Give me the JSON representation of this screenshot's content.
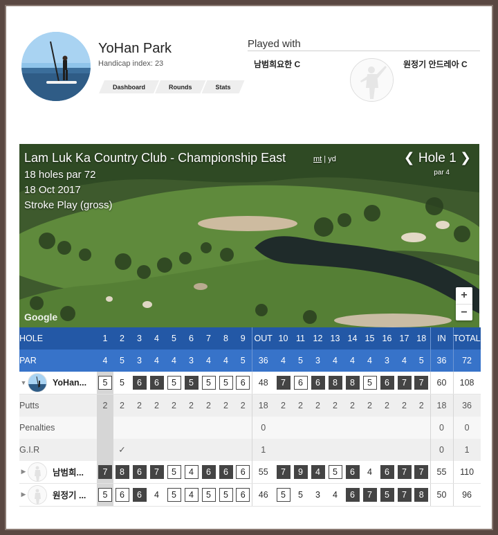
{
  "profile": {
    "name": "YoHan Park",
    "handicap": "Handicap index: 23",
    "nav": [
      "Dashboard",
      "Rounds",
      "Stats"
    ]
  },
  "played_with": {
    "title": "Played with",
    "partners": [
      "남범희요한 C",
      "원정기 안드레아 C"
    ]
  },
  "map": {
    "course": "Lam Luk Ka Country Club - Championship East",
    "units_mt": "mt",
    "units_sep": "|",
    "units_yd": "yd",
    "holes_par": "18 holes par 72",
    "date": "18 Oct 2017",
    "format": "Stroke Play (gross)",
    "hole_label": "Hole 1",
    "hole_prev": "❮",
    "hole_next": "❯",
    "hole_par": "par 4",
    "zoom_in": "+",
    "zoom_out": "−",
    "google": "Google"
  },
  "scorecard": {
    "hole_label": "HOLE",
    "par_label": "PAR",
    "holes": [
      "1",
      "2",
      "3",
      "4",
      "5",
      "6",
      "7",
      "8",
      "9",
      "OUT",
      "10",
      "11",
      "12",
      "13",
      "14",
      "15",
      "16",
      "17",
      "18",
      "IN",
      "TOTAL"
    ],
    "pars": [
      "4",
      "5",
      "3",
      "4",
      "4",
      "3",
      "4",
      "4",
      "5",
      "36",
      "4",
      "5",
      "3",
      "4",
      "4",
      "4",
      "3",
      "4",
      "5",
      "36",
      "72"
    ],
    "rows": [
      {
        "type": "player",
        "name": "YoHan...",
        "expanded": true,
        "cells": [
          {
            "v": "5",
            "s": "box"
          },
          {
            "v": "5",
            "s": "plain"
          },
          {
            "v": "6",
            "s": "dark"
          },
          {
            "v": "6",
            "s": "dark"
          },
          {
            "v": "5",
            "s": "box"
          },
          {
            "v": "5",
            "s": "dark"
          },
          {
            "v": "5",
            "s": "box"
          },
          {
            "v": "5",
            "s": "box"
          },
          {
            "v": "6",
            "s": "box"
          },
          {
            "v": "48",
            "s": "sum"
          },
          {
            "v": "7",
            "s": "dark"
          },
          {
            "v": "6",
            "s": "box"
          },
          {
            "v": "6",
            "s": "dark"
          },
          {
            "v": "8",
            "s": "dark"
          },
          {
            "v": "8",
            "s": "dark"
          },
          {
            "v": "5",
            "s": "box"
          },
          {
            "v": "6",
            "s": "dark"
          },
          {
            "v": "7",
            "s": "dark"
          },
          {
            "v": "7",
            "s": "dark"
          },
          {
            "v": "60",
            "s": "sum"
          },
          {
            "v": "108",
            "s": "sum"
          }
        ]
      },
      {
        "type": "stat",
        "name": "Putts",
        "cells": [
          "2",
          "2",
          "2",
          "2",
          "2",
          "2",
          "2",
          "2",
          "2",
          "18",
          "2",
          "2",
          "2",
          "2",
          "2",
          "2",
          "2",
          "2",
          "2",
          "18",
          "36"
        ]
      },
      {
        "type": "stat",
        "name": "Penalties",
        "cells": [
          "",
          "",
          "",
          "",
          "",
          "",
          "",
          "",
          "",
          "0",
          "",
          "",
          "",
          "",
          "",
          "",
          "",
          "",
          "",
          "0",
          "0"
        ]
      },
      {
        "type": "stat",
        "name": "G.I.R",
        "cells": [
          "",
          "✓",
          "",
          "",
          "",
          "",
          "",
          "",
          "",
          "1",
          "",
          "",
          "",
          "",
          "",
          "",
          "",
          "",
          "",
          "0",
          "1"
        ]
      },
      {
        "type": "player",
        "name": "남범희...",
        "expanded": false,
        "cells": [
          {
            "v": "7",
            "s": "dark"
          },
          {
            "v": "8",
            "s": "dark"
          },
          {
            "v": "6",
            "s": "dark"
          },
          {
            "v": "7",
            "s": "dark"
          },
          {
            "v": "5",
            "s": "box"
          },
          {
            "v": "4",
            "s": "box"
          },
          {
            "v": "6",
            "s": "dark"
          },
          {
            "v": "6",
            "s": "dark"
          },
          {
            "v": "6",
            "s": "box"
          },
          {
            "v": "55",
            "s": "sum"
          },
          {
            "v": "7",
            "s": "dark"
          },
          {
            "v": "9",
            "s": "dark"
          },
          {
            "v": "4",
            "s": "dark"
          },
          {
            "v": "5",
            "s": "box"
          },
          {
            "v": "6",
            "s": "dark"
          },
          {
            "v": "4",
            "s": "plain"
          },
          {
            "v": "6",
            "s": "dark"
          },
          {
            "v": "7",
            "s": "dark"
          },
          {
            "v": "7",
            "s": "dark"
          },
          {
            "v": "55",
            "s": "sum"
          },
          {
            "v": "110",
            "s": "sum"
          }
        ]
      },
      {
        "type": "player",
        "name": "원정기 ...",
        "expanded": false,
        "cells": [
          {
            "v": "5",
            "s": "box"
          },
          {
            "v": "6",
            "s": "box"
          },
          {
            "v": "6",
            "s": "dark"
          },
          {
            "v": "4",
            "s": "plain"
          },
          {
            "v": "5",
            "s": "box"
          },
          {
            "v": "4",
            "s": "box"
          },
          {
            "v": "5",
            "s": "box"
          },
          {
            "v": "5",
            "s": "box"
          },
          {
            "v": "6",
            "s": "box"
          },
          {
            "v": "46",
            "s": "sum"
          },
          {
            "v": "5",
            "s": "box"
          },
          {
            "v": "5",
            "s": "plain"
          },
          {
            "v": "3",
            "s": "plain"
          },
          {
            "v": "4",
            "s": "plain"
          },
          {
            "v": "6",
            "s": "dark"
          },
          {
            "v": "7",
            "s": "dark"
          },
          {
            "v": "5",
            "s": "dark"
          },
          {
            "v": "7",
            "s": "dark"
          },
          {
            "v": "8",
            "s": "dark"
          },
          {
            "v": "50",
            "s": "sum"
          },
          {
            "v": "96",
            "s": "sum"
          }
        ]
      }
    ]
  },
  "colors": {
    "header_blue": "#2358a6",
    "par_blue": "#3773c9",
    "dark_score": "#444444"
  }
}
